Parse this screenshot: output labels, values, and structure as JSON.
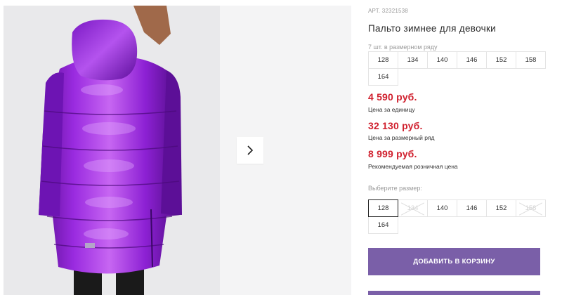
{
  "product": {
    "article": "АРТ. 32321538",
    "title": "Пальто зимнее для девочки"
  },
  "pack": {
    "info": "7 шт. в размерном ряду",
    "sizes": [
      "128",
      "134",
      "140",
      "146",
      "152",
      "158",
      "164"
    ]
  },
  "prices": {
    "unit_price": "4 590 руб.",
    "unit_label": "Цена за единицу",
    "row_price": "32 130 руб.",
    "row_label": "Цена за размерный ряд",
    "retail_price": "8 999 руб.",
    "retail_label": "Рекомендуемая розничная цена"
  },
  "size_select": {
    "label": "Выберите размер:",
    "sizes": [
      {
        "value": "128",
        "state": "selected"
      },
      {
        "value": "134",
        "state": "disabled"
      },
      {
        "value": "140",
        "state": "available"
      },
      {
        "value": "146",
        "state": "available"
      },
      {
        "value": "152",
        "state": "available"
      },
      {
        "value": "158",
        "state": "disabled"
      },
      {
        "value": "164",
        "state": "available"
      }
    ]
  },
  "actions": {
    "add_to_cart": "ДОБАВИТЬ В КОРЗИНУ"
  },
  "gallery": {
    "next_icon": "chevron-right-icon"
  },
  "colors": {
    "price": "#d0202e",
    "button": "#7a5fa8",
    "coat": "#8a1fd0"
  }
}
